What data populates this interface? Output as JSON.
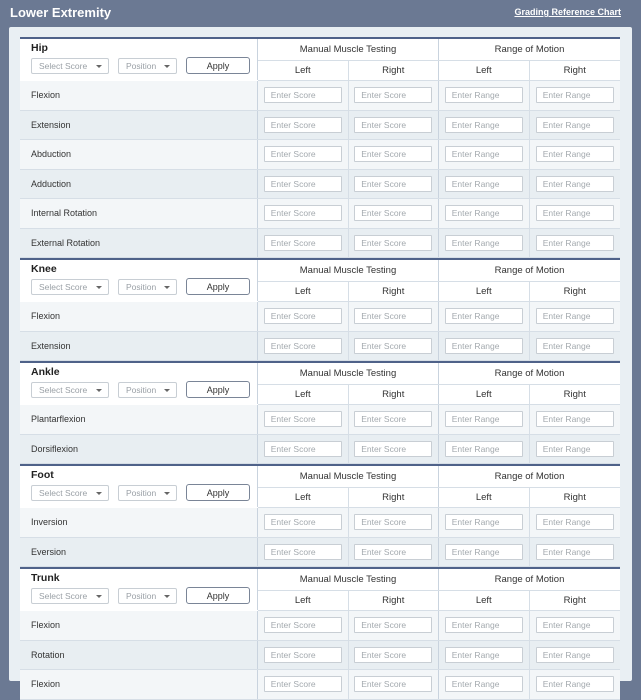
{
  "header": {
    "title": "Lower Extremity",
    "reference_link": "Grading Reference Chart"
  },
  "columns": {
    "group1": "Manual Muscle Testing",
    "group2": "Range of Motion",
    "left": "Left",
    "right": "Right"
  },
  "controls": {
    "score_placeholder": "Select Score",
    "position_placeholder": "Position",
    "apply_label": "Apply"
  },
  "placeholders": {
    "score": "Enter Score",
    "range": "Enter Range"
  },
  "sections": [
    {
      "name": "Hip",
      "movements": [
        "Flexion",
        "Extension",
        "Abduction",
        "Adduction",
        "Internal Rotation",
        "External Rotation"
      ]
    },
    {
      "name": "Knee",
      "movements": [
        "Flexion",
        "Extension"
      ]
    },
    {
      "name": "Ankle",
      "movements": [
        "Plantarflexion",
        "Dorsiflexion"
      ]
    },
    {
      "name": "Foot",
      "movements": [
        "Inversion",
        "Eversion"
      ]
    },
    {
      "name": "Trunk",
      "movements": [
        "Flexion",
        "Rotation",
        "Flexion"
      ]
    }
  ]
}
